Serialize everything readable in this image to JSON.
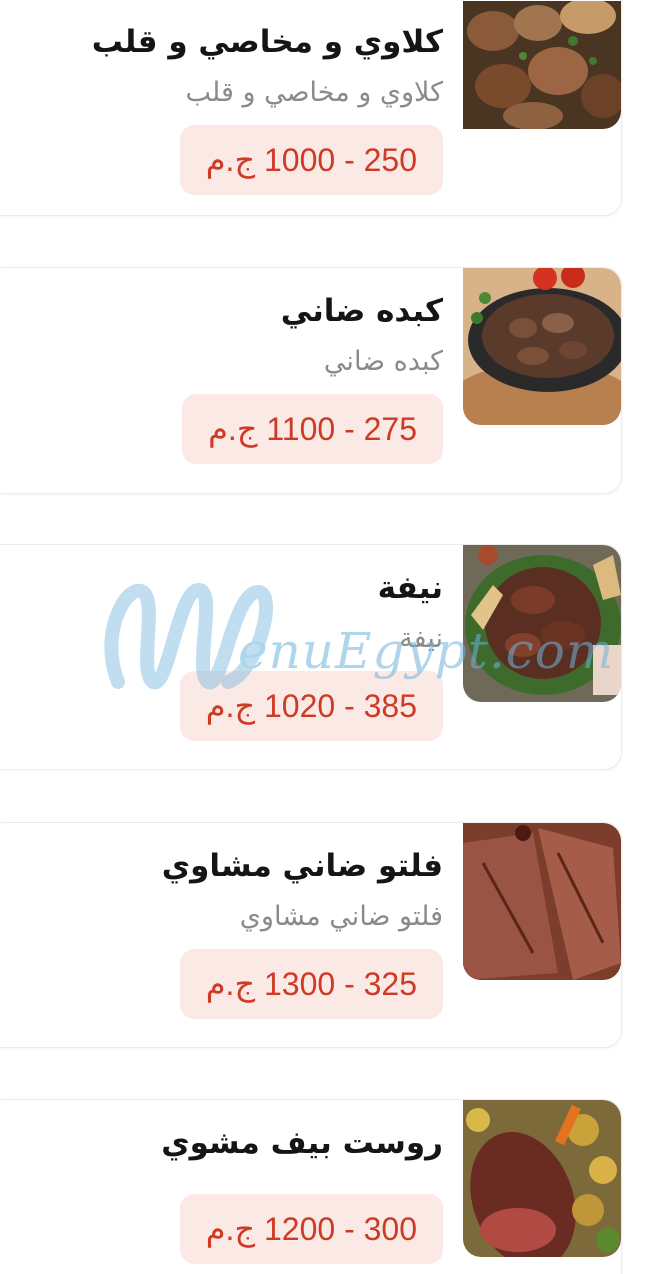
{
  "items": [
    {
      "title": "كلاوي و مخاصي و قلب",
      "description": "كلاوي و مخاصي و قلب",
      "price": "250 - 1000 ج.م",
      "image": "grilled-kidneys-photo"
    },
    {
      "title": "كبده ضاني",
      "description": "كبده ضاني",
      "price": "275 - 1100 ج.م",
      "image": "lamb-liver-skillet-photo"
    },
    {
      "title": "نيفة",
      "description": "نيفة",
      "price": "385 - 1020 ج.م",
      "image": "grilled-lamb-platter-photo"
    },
    {
      "title": "فلتو ضاني مشاوي",
      "description": "فلتو ضاني مشاوي",
      "price": "325 - 1300 ج.م",
      "image": "lamb-fillet-photo"
    },
    {
      "title": "روست بيف مشوي",
      "description": "",
      "price": "300 - 1200 ج.م",
      "image": "roast-beef-vegetables-photo"
    }
  ],
  "watermark": {
    "text": "enuEgypt.com"
  },
  "colors": {
    "price_text": "#cf3a25",
    "price_bg": "#fbe9e6",
    "watermark": "#6fb4dc"
  }
}
